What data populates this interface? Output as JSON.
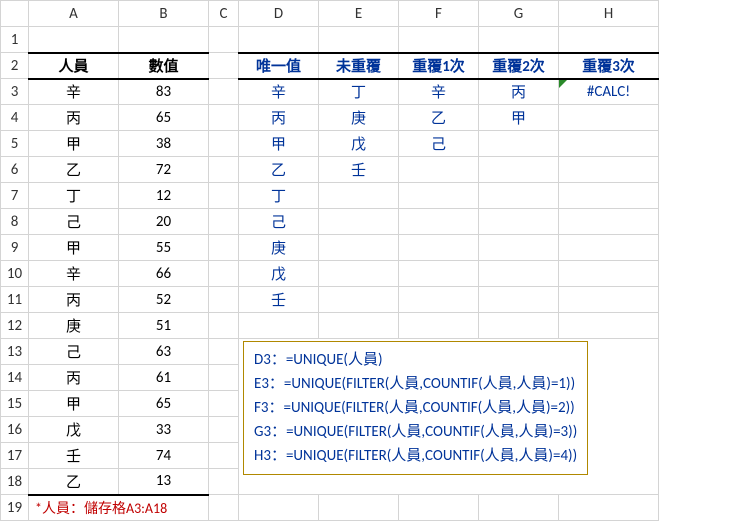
{
  "columns": [
    "A",
    "B",
    "C",
    "D",
    "E",
    "F",
    "G",
    "H"
  ],
  "rows": [
    "1",
    "2",
    "3",
    "4",
    "5",
    "6",
    "7",
    "8",
    "9",
    "10",
    "11",
    "12",
    "13",
    "14",
    "15",
    "16",
    "17",
    "18",
    "19"
  ],
  "headers": {
    "A": "人員",
    "B": "數值",
    "D": "唯一值",
    "E": "未重覆",
    "F": "重覆1次",
    "G": "重覆2次",
    "H": "重覆3次"
  },
  "personnel": [
    "辛",
    "丙",
    "甲",
    "乙",
    "丁",
    "己",
    "甲",
    "辛",
    "丙",
    "庚",
    "己",
    "丙",
    "甲",
    "戊",
    "壬",
    "乙"
  ],
  "values": [
    "83",
    "65",
    "38",
    "72",
    "12",
    "20",
    "55",
    "66",
    "52",
    "51",
    "63",
    "61",
    "65",
    "33",
    "74",
    "13"
  ],
  "unique_d": [
    "辛",
    "丙",
    "甲",
    "乙",
    "丁",
    "己",
    "庚",
    "戊",
    "壬"
  ],
  "col_e": [
    "丁",
    "庚",
    "戊",
    "壬"
  ],
  "col_f": [
    "辛",
    "乙",
    "己"
  ],
  "col_g": [
    "丙",
    "甲"
  ],
  "col_h": "#CALC!",
  "footnote": "*人員：儲存格A3:A18",
  "formulas": [
    "D3：=UNIQUE(人員)",
    "E3：=UNIQUE(FILTER(人員,COUNTIF(人員,人員)=1))",
    "F3：=UNIQUE(FILTER(人員,COUNTIF(人員,人員)=2))",
    "G3：=UNIQUE(FILTER(人員,COUNTIF(人員,人員)=3))",
    "H3：=UNIQUE(FILTER(人員,COUNTIF(人員,人員)=4))"
  ],
  "chart_data": {
    "type": "table",
    "title": "UNIQUE / FILTER / COUNTIF example",
    "source_range": "A3:B18",
    "records": [
      {
        "人員": "辛",
        "數值": 83
      },
      {
        "人員": "丙",
        "數值": 65
      },
      {
        "人員": "甲",
        "數值": 38
      },
      {
        "人員": "乙",
        "數值": 72
      },
      {
        "人員": "丁",
        "數值": 12
      },
      {
        "人員": "己",
        "數值": 20
      },
      {
        "人員": "甲",
        "數值": 55
      },
      {
        "人員": "辛",
        "數值": 66
      },
      {
        "人員": "丙",
        "數值": 52
      },
      {
        "人員": "庚",
        "數值": 51
      },
      {
        "人員": "己",
        "數值": 63
      },
      {
        "人員": "丙",
        "數值": 61
      },
      {
        "人員": "甲",
        "數值": 65
      },
      {
        "人員": "戊",
        "數值": 33
      },
      {
        "人員": "壬",
        "數值": 74
      },
      {
        "人員": "乙",
        "數值": 13
      }
    ],
    "results": {
      "唯一值": [
        "辛",
        "丙",
        "甲",
        "乙",
        "丁",
        "己",
        "庚",
        "戊",
        "壬"
      ],
      "未重覆": [
        "丁",
        "庚",
        "戊",
        "壬"
      ],
      "重覆1次": [
        "辛",
        "乙",
        "己"
      ],
      "重覆2次": [
        "丙",
        "甲"
      ],
      "重覆3次": "#CALC!"
    }
  }
}
